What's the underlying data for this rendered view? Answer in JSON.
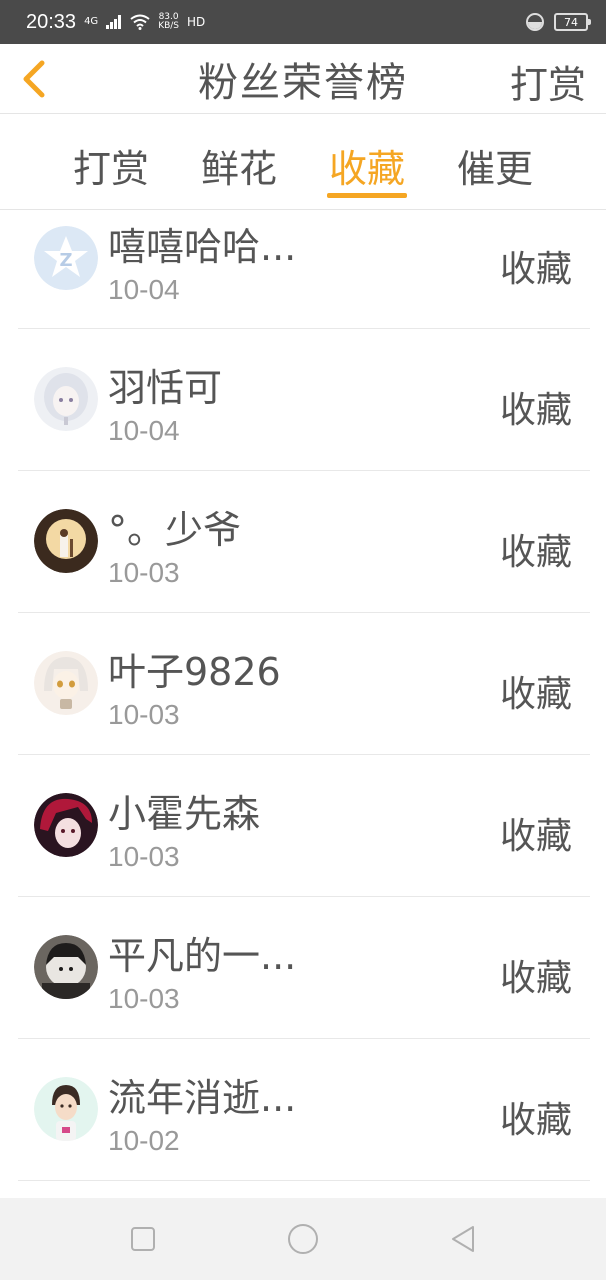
{
  "status_bar": {
    "time": "20:33",
    "network": "4G",
    "speed_value": "83.0",
    "speed_unit": "KB/S",
    "hd": "HD",
    "battery": "74"
  },
  "header": {
    "title": "粉丝荣誉榜",
    "reward_label": "打赏",
    "back_icon": "chevron-left-icon"
  },
  "tabs": [
    {
      "label": "打赏",
      "active": false
    },
    {
      "label": "鲜花",
      "active": false
    },
    {
      "label": "收藏",
      "active": true
    },
    {
      "label": "催更",
      "active": false
    }
  ],
  "list": [
    {
      "name": "嘻嘻哈哈...",
      "date": "10-04",
      "action": "收藏"
    },
    {
      "name": "羽恬可",
      "date": "10-04",
      "action": "收藏"
    },
    {
      "name": "°。少爷",
      "date": "10-03",
      "action": "收藏"
    },
    {
      "name": "叶子9826",
      "date": "10-03",
      "action": "收藏"
    },
    {
      "name": "小霍先森",
      "date": "10-03",
      "action": "收藏"
    },
    {
      "name": "平凡的一...",
      "date": "10-03",
      "action": "收藏"
    },
    {
      "name": "流年消逝...",
      "date": "10-02",
      "action": "收藏"
    }
  ],
  "colors": {
    "accent": "#f5a623",
    "status_bar": "#4a4a4a",
    "text": "#555555",
    "muted": "#999999"
  }
}
